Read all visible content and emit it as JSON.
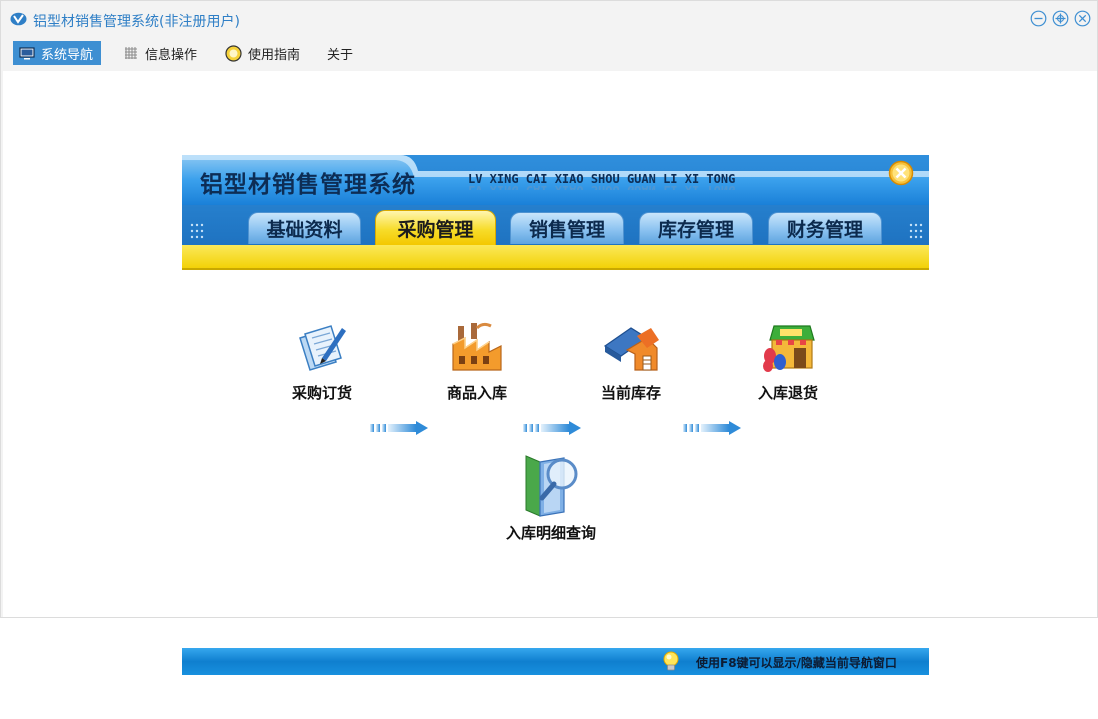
{
  "window": {
    "title": "铝型材销售管理系统(非注册用户)",
    "icon": "app-logo-icon",
    "controls": [
      "minimize-icon",
      "maximize-icon",
      "close-icon"
    ],
    "accent_color": "#3e8fd2"
  },
  "menu": {
    "items": [
      {
        "label": "系统导航",
        "icon": "monitor-icon",
        "active": true
      },
      {
        "label": "信息操作",
        "icon": "grid-icon",
        "active": false
      },
      {
        "label": "使用指南",
        "icon": "help-icon",
        "active": false
      },
      {
        "label": "关于",
        "icon": "",
        "active": false
      }
    ]
  },
  "nav": {
    "banner_title": "铝型材销售管理系统",
    "banner_subtitle": "LV XING CAI XIAO SHOU GUAN LI XI TONG",
    "tabs": [
      {
        "label": "基础资料",
        "selected": false
      },
      {
        "label": "采购管理",
        "selected": true
      },
      {
        "label": "销售管理",
        "selected": false
      },
      {
        "label": "库存管理",
        "selected": false
      },
      {
        "label": "财务管理",
        "selected": false
      }
    ],
    "workflow": [
      {
        "label": "采购订货",
        "icon": "purchase-order-icon"
      },
      {
        "label": "商品入库",
        "icon": "factory-icon"
      },
      {
        "label": "当前库存",
        "icon": "warehouse-icon"
      },
      {
        "label": "入库退货",
        "icon": "return-shop-icon"
      },
      {
        "label": "入库明细查询",
        "icon": "search-folder-icon"
      }
    ],
    "hint": "使用F8键可以显示/隐藏当前导航窗口",
    "colors": {
      "banner_blue": "#1f8fe0",
      "tab_selected": "#f7dc2a",
      "yellow_band": "#f5dc12"
    }
  }
}
